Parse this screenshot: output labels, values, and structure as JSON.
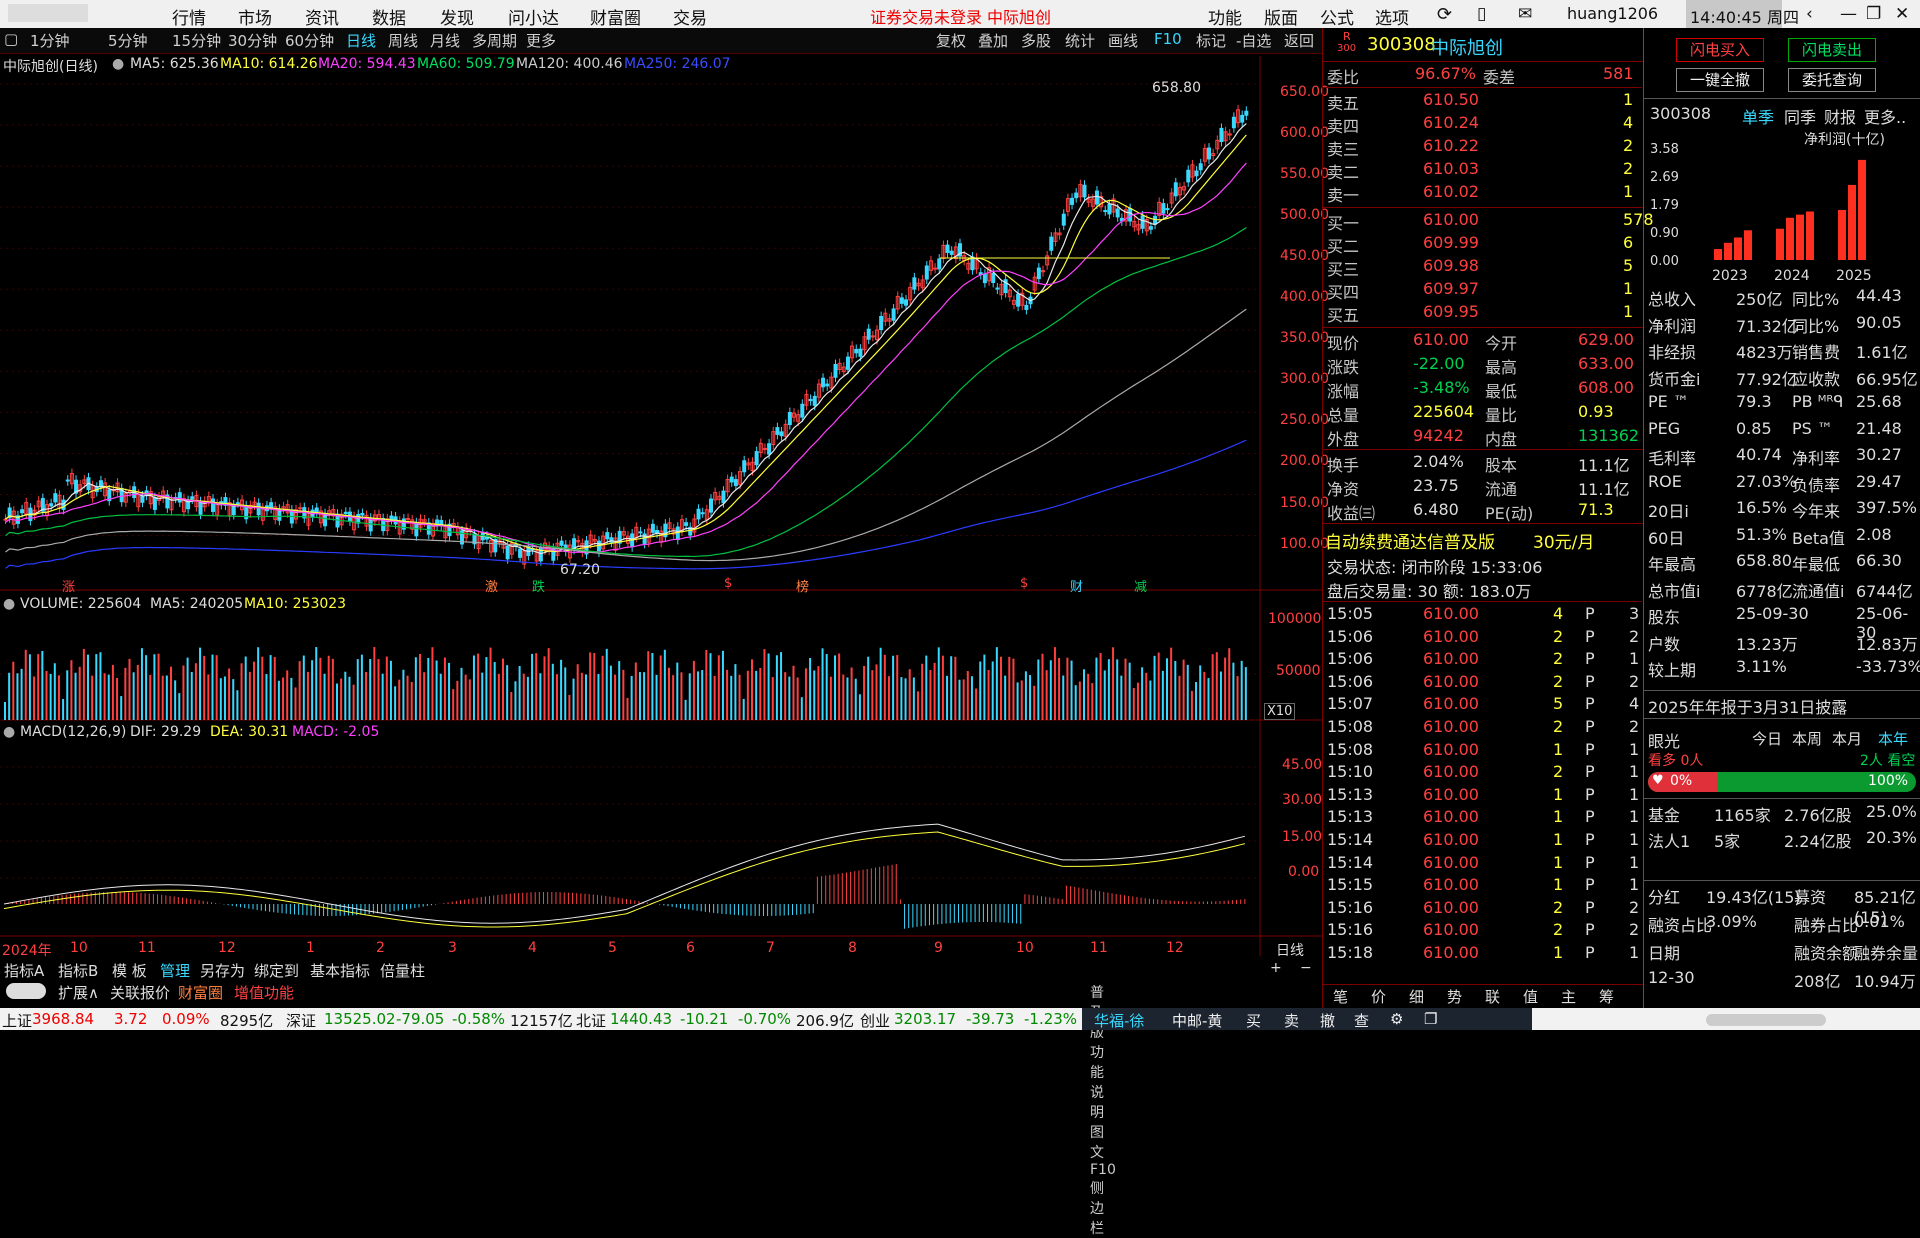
{
  "menubar": {
    "items": [
      "行情",
      "市场",
      "资讯",
      "数据",
      "发现",
      "问小达",
      "财富圈",
      "交易"
    ],
    "notice": "证券交易未登录",
    "stock_name": "中际旭创",
    "right_items": [
      "功能",
      "版面",
      "公式",
      "选项"
    ],
    "user": "huang1206",
    "clock": "14:40:45 周四"
  },
  "toolbar": {
    "periods": [
      "1分钟",
      "5分钟",
      "15分钟",
      "30分钟",
      "60分钟",
      "日线",
      "周线",
      "月线",
      "多周期",
      "更多"
    ],
    "active_period": "日线",
    "tools": [
      "复权",
      "叠加",
      "多股",
      "统计",
      "画线",
      "F10",
      "标记",
      "-自选",
      "返回"
    ]
  },
  "ma_line": {
    "title": "中际旭创(日线)",
    "ma5": "MA5: 625.36",
    "ma10": "MA10: 614.26",
    "ma20": "MA20: 594.43",
    "ma60": "MA60: 509.79",
    "ma120": "MA120: 400.46",
    "ma250": "MA250: 246.07"
  },
  "price_axis": [
    "650.00",
    "600.00",
    "550.00",
    "500.00",
    "450.00",
    "400.00",
    "350.00",
    "300.00",
    "250.00",
    "200.00",
    "150.00",
    "100.00"
  ],
  "annotations": {
    "high": "658.80",
    "low": "67.20"
  },
  "event_marks": [
    {
      "t": "涨",
      "color": "#ff4040"
    },
    {
      "t": "激",
      "color": "#ff8040"
    },
    {
      "t": "跌",
      "color": "#00d050"
    },
    {
      "t": "$",
      "color": "#ff4040"
    },
    {
      "t": "榜",
      "color": "#ff8040"
    },
    {
      "t": "$",
      "color": "#ff4040"
    },
    {
      "t": "财",
      "color": "#38d8ff"
    },
    {
      "t": "减",
      "color": "#00d050"
    }
  ],
  "volume": {
    "label": "VOLUME: 225604",
    "ma5": "MA5: 240205",
    "ma10": "MA10: 253023",
    "axis": [
      "100000",
      "50000"
    ],
    "unit": "X10"
  },
  "macd": {
    "label": "MACD(12,26,9)",
    "dif": "DIF: 29.29",
    "dea": "DEA: 30.31",
    "macd": "MACD: -2.05",
    "axis": [
      "45.00",
      "30.00",
      "15.00",
      "0.00"
    ]
  },
  "time_axis": {
    "year": "2024年",
    "months": [
      "10",
      "11",
      "12",
      "1",
      "2",
      "3",
      "4",
      "5",
      "6",
      "7",
      "8",
      "9",
      "10",
      "11",
      "12"
    ],
    "mode": "日线"
  },
  "bottom_tabs": [
    "指标A",
    "指标B",
    "模 板",
    "管理",
    "另存为",
    "绑定到",
    "基本指标",
    "倍量柱"
  ],
  "bottom_tabs2": [
    "扩展∧",
    "关联报价",
    "财富圈",
    "增值功能"
  ],
  "quote": {
    "code": "300308",
    "name": "中际旭创",
    "r_label": "R",
    "r_sub": "300",
    "weibi_label": "委比",
    "weibi": "96.67%",
    "weicha_label": "委差",
    "weicha": "581",
    "asks": [
      [
        "卖五",
        "610.50",
        "1"
      ],
      [
        "卖四",
        "610.24",
        "4"
      ],
      [
        "卖三",
        "610.22",
        "2"
      ],
      [
        "卖二",
        "610.03",
        "2"
      ],
      [
        "卖一",
        "610.02",
        "1"
      ]
    ],
    "bids": [
      [
        "买一",
        "610.00",
        "578"
      ],
      [
        "买二",
        "609.99",
        "6"
      ],
      [
        "买三",
        "609.98",
        "5"
      ],
      [
        "买四",
        "609.97",
        "1"
      ],
      [
        "买五",
        "609.95",
        "1"
      ]
    ],
    "stats": [
      [
        "现价",
        "610.00",
        "今开",
        "629.00"
      ],
      [
        "涨跌",
        "-22.00",
        "最高",
        "633.00"
      ],
      [
        "涨幅",
        "-3.48%",
        "最低",
        "608.00"
      ],
      [
        "总量",
        "225604",
        "量比",
        "0.93"
      ],
      [
        "外盘",
        "94242",
        "内盘",
        "131362"
      ]
    ],
    "stats2": [
      [
        "换手",
        "2.04%",
        "股本",
        "11.1亿"
      ],
      [
        "净资",
        "23.75",
        "流通",
        "11.1亿"
      ],
      [
        "收益㈢",
        "6.480",
        "PE(动)",
        "71.3"
      ]
    ],
    "promo": "自动续费通达信普及版",
    "promo_price": "30元/月",
    "trade_status": "交易状态: 闭市阶段 15:33:06",
    "after_hours": "盘后交易量: 30  额: 183.0万"
  },
  "ticks": [
    [
      "15:05",
      "610.00",
      "4",
      "P",
      "3"
    ],
    [
      "15:06",
      "610.00",
      "2",
      "P",
      "2"
    ],
    [
      "15:06",
      "610.00",
      "2",
      "P",
      "1"
    ],
    [
      "15:06",
      "610.00",
      "2",
      "P",
      "2"
    ],
    [
      "15:07",
      "610.00",
      "5",
      "P",
      "4"
    ],
    [
      "15:08",
      "610.00",
      "2",
      "P",
      "2"
    ],
    [
      "15:08",
      "610.00",
      "1",
      "P",
      "1"
    ],
    [
      "15:10",
      "610.00",
      "2",
      "P",
      "1"
    ],
    [
      "15:13",
      "610.00",
      "1",
      "P",
      "1"
    ],
    [
      "15:13",
      "610.00",
      "1",
      "P",
      "1"
    ],
    [
      "15:14",
      "610.00",
      "1",
      "P",
      "1"
    ],
    [
      "15:14",
      "610.00",
      "1",
      "P",
      "1"
    ],
    [
      "15:15",
      "610.00",
      "1",
      "P",
      "1"
    ],
    [
      "15:16",
      "610.00",
      "2",
      "P",
      "2"
    ],
    [
      "15:16",
      "610.00",
      "2",
      "P",
      "2"
    ],
    [
      "15:18",
      "610.00",
      "1",
      "P",
      "1"
    ]
  ],
  "quote_bottom_tabs": [
    "笔",
    "价",
    "细",
    "势",
    "联",
    "值",
    "主",
    "筹"
  ],
  "fundamentals": {
    "buttons": [
      "闪电买入",
      "闪电卖出",
      "一键全撤",
      "委托查询"
    ],
    "code": "300308",
    "tabs": [
      "单季",
      "同季",
      "财报",
      "更多.."
    ],
    "chart_title": "净利润(十亿)",
    "chart_ticks": [
      "3.58",
      "2.69",
      "1.79",
      "0.90",
      "0.00"
    ],
    "chart_years": [
      "2023",
      "2024",
      "2025"
    ],
    "chart_data": {
      "type": "bar",
      "ylabel": "净利润(十亿)",
      "ylim": [
        0,
        3.58
      ],
      "categories": [
        "2023Q1",
        "2023Q2",
        "2023Q3",
        "2023Q4",
        "2024Q1",
        "2024Q2",
        "2024Q3",
        "2024Q4",
        "2025Q1",
        "2025Q2",
        "2025Q3"
      ],
      "values": [
        0.35,
        0.55,
        0.72,
        0.95,
        1.0,
        1.35,
        1.45,
        1.55,
        1.6,
        2.4,
        3.2
      ]
    },
    "rows": [
      [
        "总收入",
        "250亿",
        "同比%",
        "44.43"
      ],
      [
        "净利润",
        "71.32亿",
        "同比%",
        "90.05"
      ],
      [
        "非经损",
        "4823万",
        "销售费",
        "1.61亿"
      ],
      [
        "货币金i",
        "77.92亿",
        "应收款",
        "66.95亿"
      ],
      [
        "PE ™",
        "79.3",
        "PB ᴹᴿᑫ",
        "25.68"
      ],
      [
        "PEG",
        "0.85",
        "PS ™",
        "21.48"
      ],
      [
        "毛利率",
        "40.74",
        "净利率",
        "30.27"
      ],
      [
        "ROE",
        "27.03%",
        "负债率",
        "29.47"
      ],
      [
        "20日i",
        "16.5%",
        "今年来",
        "397.5%"
      ],
      [
        "60日",
        "51.3%",
        "Beta值",
        "2.08"
      ],
      [
        "年最高",
        "658.80",
        "年最低",
        "66.30"
      ],
      [
        "总市值i",
        "6778亿",
        "流通值i",
        "6744亿"
      ],
      [
        "股东",
        "25-09-30",
        "",
        "25-06-30"
      ],
      [
        "户数",
        "13.23万",
        "",
        "12.83万"
      ],
      [
        "较上期",
        "3.11%",
        "",
        "-33.73%"
      ]
    ],
    "report_note": "2025年年报于3月31日披露",
    "vision": {
      "title": "眼光",
      "tabs": [
        "今日",
        "本周",
        "本月",
        "本年"
      ],
      "bull": "看多 0人",
      "bear": "2人 看空",
      "pct_bull": "0%",
      "pct_bear": "100%"
    },
    "funds": [
      [
        "基金",
        "1165家",
        "2.76亿股",
        "25.0%"
      ],
      [
        "法人1",
        "5家",
        "2.24亿股",
        "20.3%"
      ]
    ],
    "fin": [
      [
        "分红",
        "19.43亿(15)",
        "募资",
        "85.21亿(15)"
      ],
      [
        "融资占比",
        "3.09%",
        "融券占比",
        "0.01%"
      ],
      [
        "日期",
        "",
        "融资余额",
        "融券余量"
      ],
      [
        "12-30",
        "",
        "208亿",
        "10.94万"
      ]
    ]
  },
  "statusbar": {
    "sh": "上证",
    "sh_v": "3968.84",
    "sh_c": "3.72",
    "sh_p": "0.09%",
    "sh_a": "8295亿",
    "sz": "深证",
    "sz_v": "13525.02",
    "sz_c": "-79.05",
    "sz_p": "-0.58%",
    "sz_a": "12157亿",
    "bz": "北证",
    "bz_v": "1440.43",
    "bz_c": "-10.21",
    "bz_p": "-0.70%",
    "bz_a": "206.9亿",
    "cy": "创业",
    "cy_v": "3203.17",
    "cy_c": "-39.73",
    "cy_p": "-1.23%",
    "tabs": [
      "华福-徐",
      "中邮-黄",
      "买",
      "卖",
      "撤",
      "查"
    ]
  },
  "help_text": "普及版功能说明 图文F10 侧边栏"
}
